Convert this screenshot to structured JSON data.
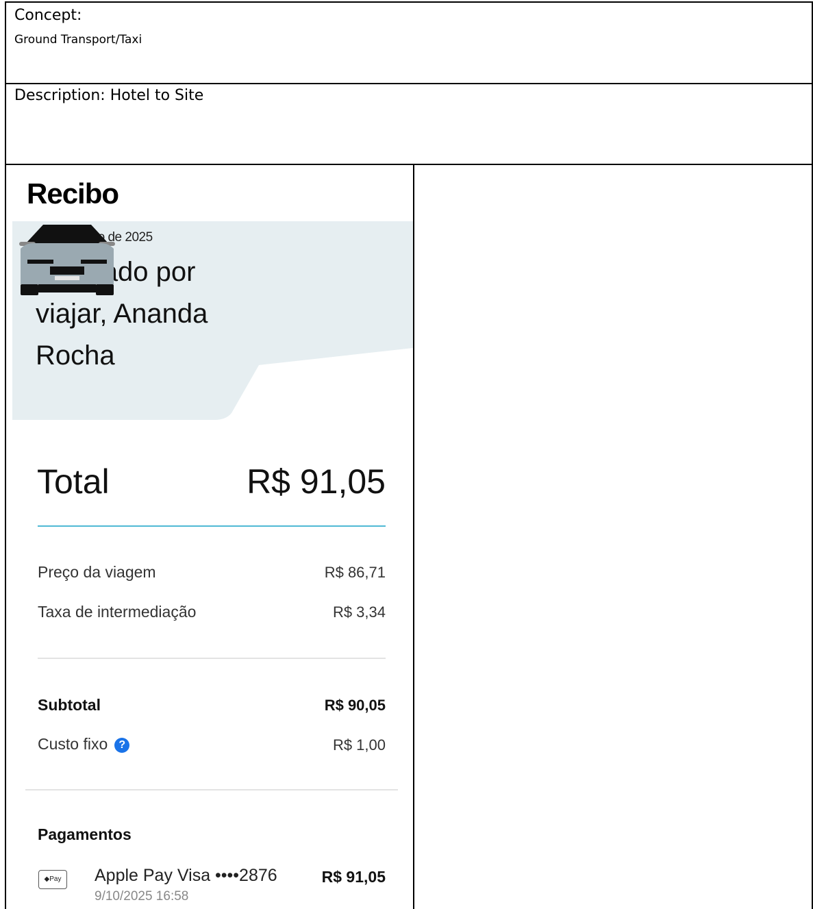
{
  "concept": {
    "label": "Concept:",
    "value": "Ground Transport/Taxi"
  },
  "description": {
    "text": "Description: Hotel to Site"
  },
  "receipt": {
    "title": "Recibo",
    "date": "9 de outubro de 2025",
    "message": "Obrigado por viajar, Ananda Rocha",
    "total_label": "Total",
    "total_value": "R$ 91,05",
    "lines": [
      {
        "label": "Preço da viagem",
        "value": "R$ 86,71"
      },
      {
        "label": "Taxa de intermediação",
        "value": "R$ 3,34"
      }
    ],
    "subtotal_label": "Subtotal",
    "subtotal_value": "R$ 90,05",
    "fixed_label": "Custo fixo",
    "fixed_value": "R$ 1,00",
    "help_icon": "question-icon",
    "payments_title": "Pagamentos",
    "payment": {
      "icon_text": "◆Pay",
      "method": "Apple Pay Visa ••••2876",
      "date": "9/10/2025 16:58",
      "amount": "R$ 91,05"
    },
    "colors": {
      "hero_bg": "#e6eef1",
      "accent_rule": "#4fb9d4",
      "help_blue": "#1a73e8"
    }
  }
}
